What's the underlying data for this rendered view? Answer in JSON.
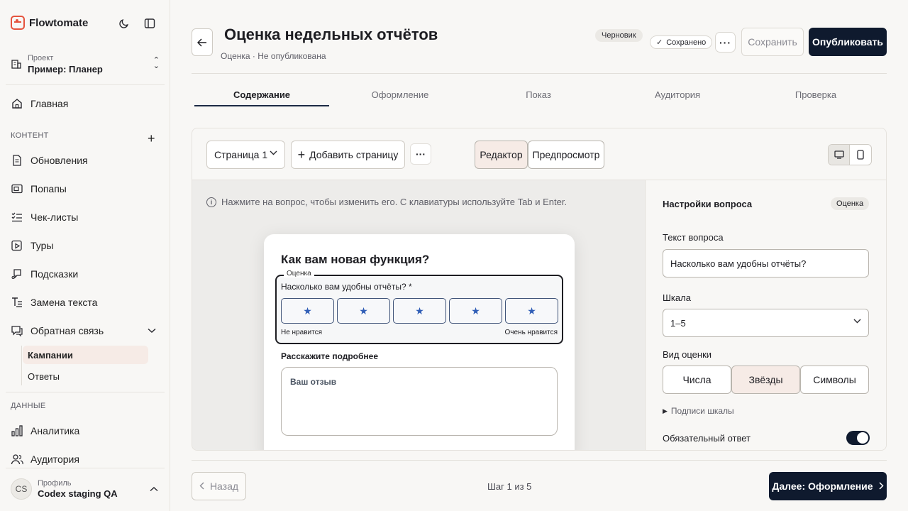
{
  "app": {
    "name": "Flowtomate"
  },
  "project": {
    "label": "Проект",
    "value": "Пример: Планер"
  },
  "sidebar": {
    "home": "Главная",
    "content_section": "КОНТЕНТ",
    "content_items": [
      {
        "label": "Обновления",
        "icon": "document-icon"
      },
      {
        "label": "Попапы",
        "icon": "popup-icon"
      },
      {
        "label": "Чек-листы",
        "icon": "checklist-icon"
      },
      {
        "label": "Туры",
        "icon": "tour-icon"
      },
      {
        "label": "Подсказки",
        "icon": "hint-icon"
      },
      {
        "label": "Замена текста",
        "icon": "text-replace-icon"
      },
      {
        "label": "Обратная связь",
        "icon": "feedback-icon"
      }
    ],
    "feedback_sub": [
      "Кампании",
      "Ответы"
    ],
    "data_section": "ДАННЫЕ",
    "data_items": [
      {
        "label": "Аналитика",
        "icon": "analytics-icon"
      },
      {
        "label": "Аудитория",
        "icon": "audience-icon"
      }
    ]
  },
  "profile": {
    "initials": "CS",
    "label": "Профиль",
    "value": "Codex staging QA"
  },
  "header": {
    "title": "Оценка недельных отчётов",
    "subtitle": "Оценка · Не опубликована",
    "draft_badge": "Черновик",
    "saved_badge": "Сохранено",
    "save_label": "Сохранить",
    "publish_label": "Опубликовать"
  },
  "tabs": [
    "Содержание",
    "Оформление",
    "Показ",
    "Аудитория",
    "Проверка"
  ],
  "toolbar": {
    "page_select": "Страница 1",
    "add_page": "Добавить страницу",
    "editor": "Редактор",
    "preview": "Предпросмотр"
  },
  "canvas": {
    "hint": "Нажмите на вопрос, чтобы изменить его. С клавиатуры используйте Tab и Enter.",
    "survey_title": "Как вам новая функция?",
    "q_legend": "Оценка",
    "q_label": "Насколько вам удобны отчёты? *",
    "stars_count": 5,
    "scale_low": "Не нравится",
    "scale_high": "Очень нравится",
    "tell_more": "Расскажите подробнее",
    "textarea_placeholder": "Ваш отзыв"
  },
  "settings": {
    "title": "Настройки вопроса",
    "badge": "Оценка",
    "question_text_label": "Текст вопроса",
    "question_text_value": "Насколько вам удобны отчёты?",
    "scale_label": "Шкала",
    "scale_value": "1–5",
    "view_label": "Вид оценки",
    "view_options": [
      "Числа",
      "Звёзды",
      "Символы"
    ],
    "view_selected": "Звёзды",
    "scale_captions": "Подписи шкалы",
    "required_label": "Обязательный ответ",
    "required_on": true
  },
  "footer": {
    "back": "Назад",
    "step": "Шаг 1 из 5",
    "next": "Далее: Оформление"
  },
  "colors": {
    "accent": "#0f1a2e",
    "brand": "#e5533d",
    "star": "#2f5db6",
    "selected_bg": "#f6ebe6"
  }
}
